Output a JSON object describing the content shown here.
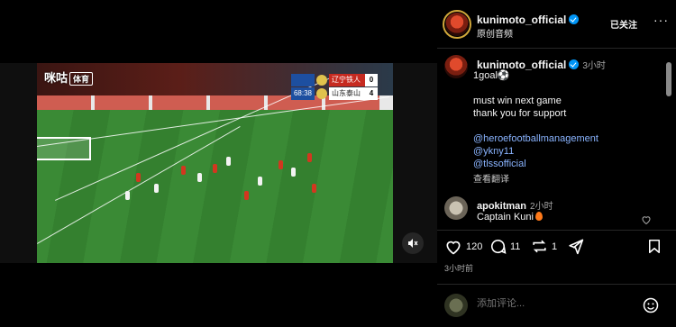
{
  "video": {
    "watermark": "咪咕",
    "watermark_badge": "体育",
    "scoreboard": {
      "time": "68:38",
      "home": {
        "name": "辽宁铁人",
        "score": "0"
      },
      "away": {
        "name": "山东泰山",
        "score": "4"
      }
    },
    "mute_icon": "speaker-muted-icon"
  },
  "header": {
    "username": "kunimoto_official",
    "audio": "原创音频",
    "follow_label": "已关注",
    "more_label": "···"
  },
  "caption": {
    "username": "kunimoto_official",
    "time": "3小时",
    "lines": [
      "1goal⚽",
      "",
      "must win next game",
      "thank you for support",
      ""
    ],
    "mentions": [
      "@heroefootballmanagement",
      "@ykny11",
      "@tlssofficial"
    ],
    "translate_label": "查看翻译"
  },
  "comment": {
    "username": "apokitman",
    "time": "2小时",
    "text": "Captain Kuni"
  },
  "actions": {
    "likes": "120",
    "comments": "11",
    "reposts": "1",
    "posted_ago": "3小时前"
  },
  "composer": {
    "placeholder": "添加评论..."
  },
  "colors": {
    "accent": "#0095f6",
    "mention": "#8ab4ff",
    "background": "#000000"
  }
}
